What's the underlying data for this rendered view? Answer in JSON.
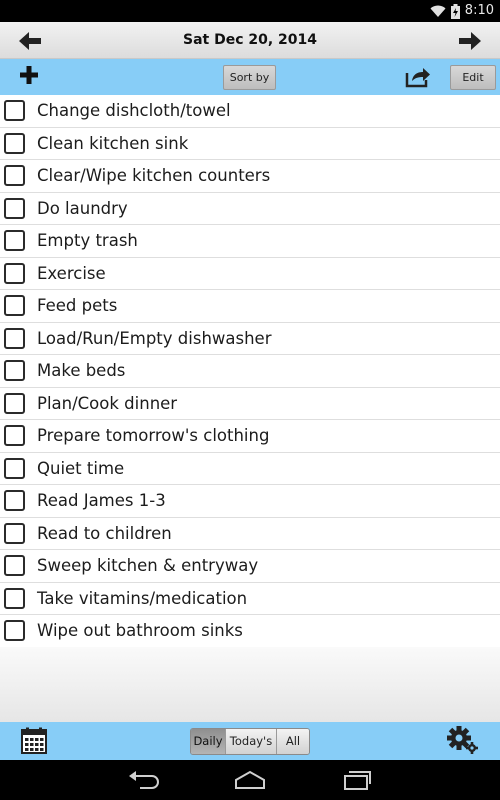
{
  "status_bar": {
    "time": "8:10",
    "wifi_icon": "wifi-icon",
    "battery_icon": "battery-charging-icon"
  },
  "header": {
    "date": "Sat Dec 20, 2014",
    "prev_icon": "arrow-left-icon",
    "next_icon": "arrow-right-icon"
  },
  "toolbar": {
    "add_icon": "plus-icon",
    "sort_label": "Sort by",
    "share_icon": "share-icon",
    "edit_label": "Edit",
    "background": "#87cdf7"
  },
  "tasks": [
    {
      "label": "Change dishcloth/towel",
      "checked": false
    },
    {
      "label": "Clean kitchen sink",
      "checked": false
    },
    {
      "label": "Clear/Wipe kitchen counters",
      "checked": false
    },
    {
      "label": "Do laundry",
      "checked": false
    },
    {
      "label": "Empty trash",
      "checked": false
    },
    {
      "label": "Exercise",
      "checked": false
    },
    {
      "label": "Feed pets",
      "checked": false
    },
    {
      "label": "Load/Run/Empty dishwasher",
      "checked": false
    },
    {
      "label": "Make beds",
      "checked": false
    },
    {
      "label": "Plan/Cook dinner",
      "checked": false
    },
    {
      "label": "Prepare tomorrow's clothing",
      "checked": false
    },
    {
      "label": "Quiet time",
      "checked": false
    },
    {
      "label": "Read James 1-3",
      "checked": false
    },
    {
      "label": "Read to children",
      "checked": false
    },
    {
      "label": "Sweep kitchen & entryway",
      "checked": false
    },
    {
      "label": "Take vitamins/medication",
      "checked": false
    },
    {
      "label": "Wipe out bathroom sinks",
      "checked": false
    }
  ],
  "bottom_bar": {
    "calendar_icon": "calendar-icon",
    "filters": [
      {
        "label": "Daily",
        "active": true
      },
      {
        "label": "Today's",
        "active": false
      },
      {
        "label": "All",
        "active": false
      }
    ],
    "settings_icon": "gear-icon"
  },
  "system_nav": {
    "back_icon": "back-icon",
    "home_icon": "home-icon",
    "recents_icon": "recents-icon"
  }
}
